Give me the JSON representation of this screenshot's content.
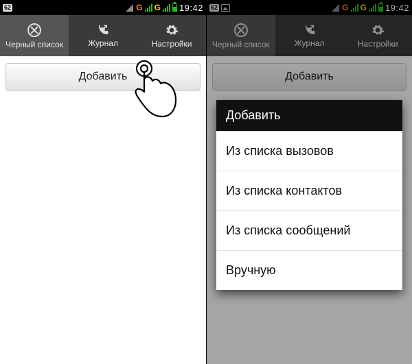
{
  "status": {
    "batteryBadge": "62",
    "networkLabel1": "G",
    "networkLabel2": "G",
    "time": "19:42"
  },
  "tabs": {
    "blacklist": "Черный список",
    "journal": "Журнал",
    "settings": "Настройки"
  },
  "addButton": "Добавить",
  "dialog": {
    "title": "Добавить",
    "items": [
      "Из списка вызовов",
      "Из списка контактов",
      "Из списка сообщений",
      "Вручную"
    ]
  }
}
